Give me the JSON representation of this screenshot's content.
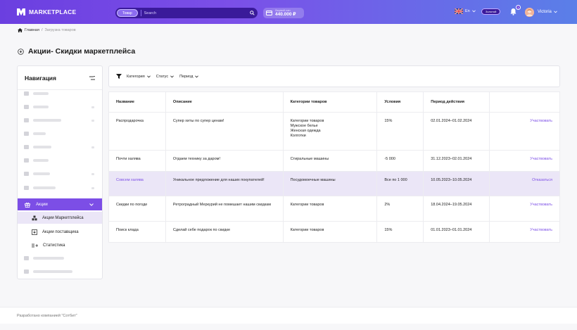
{
  "header": {
    "logo_text": "MARKETPLACE",
    "search_scope": "Товар",
    "search_placeholder": "Search",
    "balance_label": "Лицевой счет",
    "balance_amount": "440.000 ₽",
    "language": "En",
    "gold_badge": "Золотой",
    "notification_count": "1",
    "user_name": "Victoria"
  },
  "breadcrumb": {
    "home": "Главная",
    "separator": "/",
    "current": "Загрузка товаров"
  },
  "page": {
    "title": "Акции- Скидки маркетплейса"
  },
  "sidebar": {
    "title": "Навигация",
    "active_section": "Акции",
    "sub_items": [
      {
        "label": "Акции Маркетплейса"
      },
      {
        "label": "Акции поставщика"
      },
      {
        "label": "Статистика"
      }
    ]
  },
  "filters": {
    "items": [
      {
        "label": "Категория"
      },
      {
        "label": "Статус"
      },
      {
        "label": "Период"
      }
    ]
  },
  "table": {
    "columns": [
      "Название",
      "Описание",
      "Категории товаров",
      "Условия",
      "Период действия",
      ""
    ],
    "rows": [
      {
        "name": "Распродарочка",
        "description": "Супер хиты по супер ценам!",
        "categories": [
          "Категории товаров",
          "Мужское белье",
          "Женская одежда",
          "Колготки"
        ],
        "conditions": "15%",
        "period": "02.01.2024–01.02.2024",
        "action": "Участвовать"
      },
      {
        "name": "Почти халява",
        "description": "Отдаем технику за даром!",
        "categories": [
          "Стиральные машины"
        ],
        "conditions": "-5 000",
        "period": "31.12.2023–02.01.2024",
        "action": "Участвовать"
      },
      {
        "name": "Совсем халява",
        "description": "Уникальное предложение для наших покупателей!",
        "categories": [
          "Посудомоечные машины"
        ],
        "conditions": "Все по 1 000",
        "period": "10.05.2023–10.05.2024",
        "action": "Отказаться"
      },
      {
        "name": "Скидки по погоде",
        "description": "Ретроградный Меркурий не помешает нашим скидкам",
        "categories": [
          "Категории товаров"
        ],
        "conditions": "2%",
        "period": "18.04.2024–19.05.2024",
        "action": "Участвовать"
      },
      {
        "name": "Поиск клада",
        "description": "Сделай себе подарок по скидке",
        "categories": [
          "Категории товаров"
        ],
        "conditions": "15%",
        "period": "01.01.2023–01.01.2024",
        "action": "Участвовать"
      }
    ]
  },
  "footer": {
    "text": "Разработано компанией \"Сотбит\""
  },
  "colors": {
    "accent": "#7c4ee6",
    "header_start": "#6b3fe0",
    "header_end": "#5a7fe8",
    "highlight_row": "#ebe6f7"
  }
}
